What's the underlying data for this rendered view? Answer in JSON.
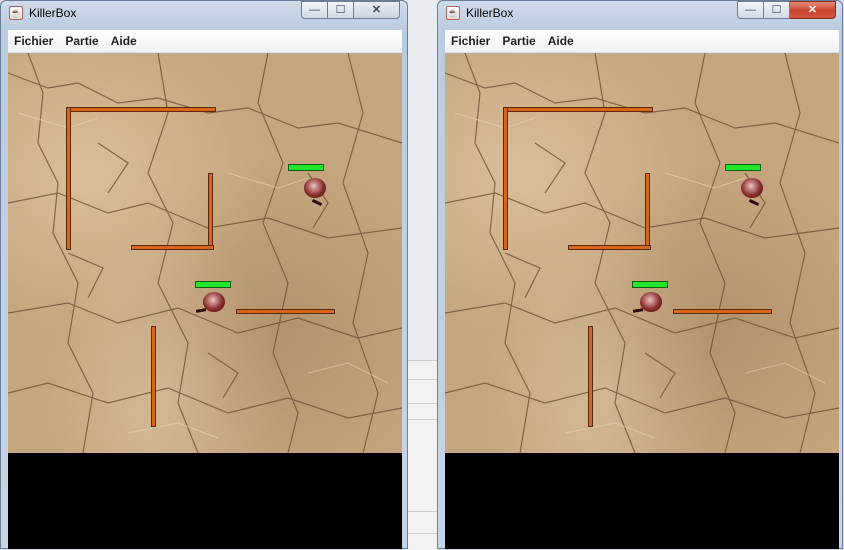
{
  "windows": [
    {
      "id": "left",
      "title": "KillerBox",
      "menu": [
        "Fichier",
        "Partie",
        "Aide"
      ],
      "icon": "java-cup-icon"
    },
    {
      "id": "right",
      "title": "KillerBox",
      "menu": [
        "Fichier",
        "Partie",
        "Aide"
      ],
      "icon": "java-cup-icon"
    }
  ],
  "controls": {
    "minimize": "—",
    "maximize": "☐",
    "close": "✕"
  },
  "colors": {
    "wall": "#d7651a",
    "health_bar": "#23e52d",
    "ground": "#c5a67e",
    "status_area": "#000000"
  }
}
